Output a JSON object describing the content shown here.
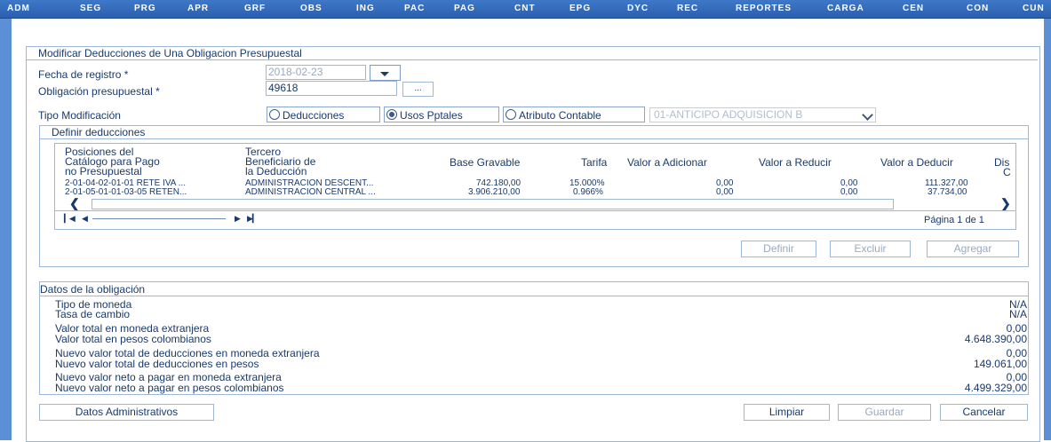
{
  "nav": [
    "ADM",
    "SEG",
    "PRG",
    "APR",
    "GRF",
    "OBS",
    "ING",
    "PAC",
    "PAG",
    "CNT",
    "EPG",
    "DYC",
    "REC",
    "REPORTES",
    "CARGA",
    "CEN",
    "CON",
    "CUN"
  ],
  "panel": {
    "title": "Modificar Deducciones de Una Obligacion Presupuestal"
  },
  "form": {
    "fecha_label": "Fecha de registro *",
    "fecha_value": "2018-02-23",
    "obligacion_label": "Obligación presupuestal *",
    "obligacion_value": "49618",
    "lookup_label": "...",
    "tipo_label": "Tipo Modificación",
    "radios": [
      {
        "label": "Deducciones",
        "checked": false
      },
      {
        "label": "Usos Pptales",
        "checked": true
      },
      {
        "label": "Atributo Contable",
        "checked": false
      }
    ],
    "atributo_value": "01-ANTICIPO ADQUISICION B"
  },
  "deducciones": {
    "title": "Definir deducciones",
    "headers": {
      "posiciones": [
        "Posiciones del",
        "Catálogo para Pago",
        "no Presupuestal"
      ],
      "tercero": [
        "Tercero",
        "Beneficiario de",
        "la Deducción"
      ],
      "base": "Base Gravable",
      "tarifa": "Tarifa",
      "adicionar": "Valor a Adicionar",
      "reducir": "Valor a Reducir",
      "deducir": "Valor a Deducir",
      "dis": [
        "Dis",
        "C"
      ]
    },
    "rows": [
      {
        "posicion": "2-01-04-02-01-01 RETE IVA ...",
        "tercero": "ADMINISTRACION DESCENT...",
        "base": "742.180,00",
        "tarifa": "15.000%",
        "adicionar": "0,00",
        "reducir": "0,00",
        "deducir": "111.327,00"
      },
      {
        "posicion": "2-01-05-01-01-03-05 RETEN...",
        "tercero": "ADMINISTRACION CENTRAL ...",
        "base": "3.906.210,00",
        "tarifa": "0.966%",
        "adicionar": "0,00",
        "reducir": "0,00",
        "deducir": "37.734,00"
      }
    ],
    "pagination": "Página 1 de 1",
    "buttons": {
      "definir": "Definir",
      "excluir": "Excluir",
      "agregar": "Agregar"
    }
  },
  "datos": {
    "title": "Datos de la obligación",
    "rows": [
      {
        "label": "Tipo de moneda",
        "value": "N/A"
      },
      {
        "label": "Tasa de cambio",
        "value": "N/A"
      },
      {
        "label": "Valor total en moneda extranjera",
        "value": "0,00"
      },
      {
        "label": "Valor total en pesos colombianos",
        "value": "4.648.390,00"
      },
      {
        "label": "Nuevo valor total de deducciones en moneda extranjera",
        "value": "0,00"
      },
      {
        "label": "Nuevo valor total de deducciones en pesos",
        "value": "149.061,00"
      },
      {
        "label": "Nuevo valor neto a pagar en moneda extranjera",
        "value": "0,00"
      },
      {
        "label": "Nuevo valor neto a pagar en pesos colombianos",
        "value": "4.499.329,00"
      }
    ]
  },
  "footer": {
    "datos_admin": "Datos Administrativos",
    "limpiar": "Limpiar",
    "guardar": "Guardar",
    "cancelar": "Cancelar"
  }
}
